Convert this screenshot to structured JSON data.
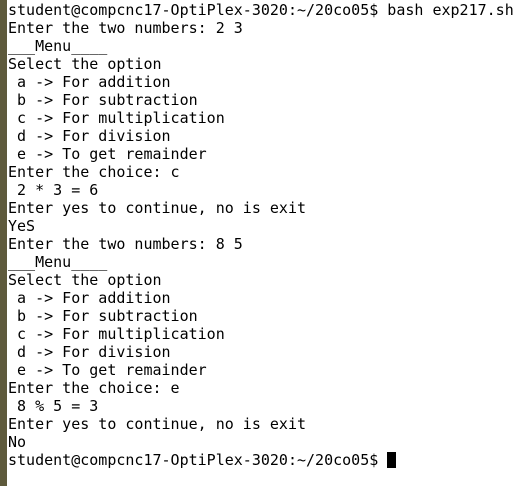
{
  "terminal": {
    "lines": [
      "student@compcnc17-OptiPlex-3020:~/20co05$ bash exp217.sh",
      "Enter the two numbers: 2 3",
      "___Menu____",
      "Select the option",
      " a -> For addition",
      " b -> For subtraction",
      " c -> For multiplication",
      " d -> For division",
      " e -> To get remainder",
      "Enter the choice: c",
      " 2 * 3 = 6",
      "Enter yes to continue, no is exit",
      "YeS",
      "Enter the two numbers: 8 5",
      "___Menu____",
      "Select the option",
      " a -> For addition",
      " b -> For subtraction",
      " c -> For multiplication",
      " d -> For division",
      " e -> To get remainder",
      "Enter the choice: e",
      " 8 % 5 = 3",
      "Enter yes to continue, no is exit",
      "No"
    ],
    "prompt": "student@compcnc17-OptiPlex-3020:~/20co05$"
  }
}
